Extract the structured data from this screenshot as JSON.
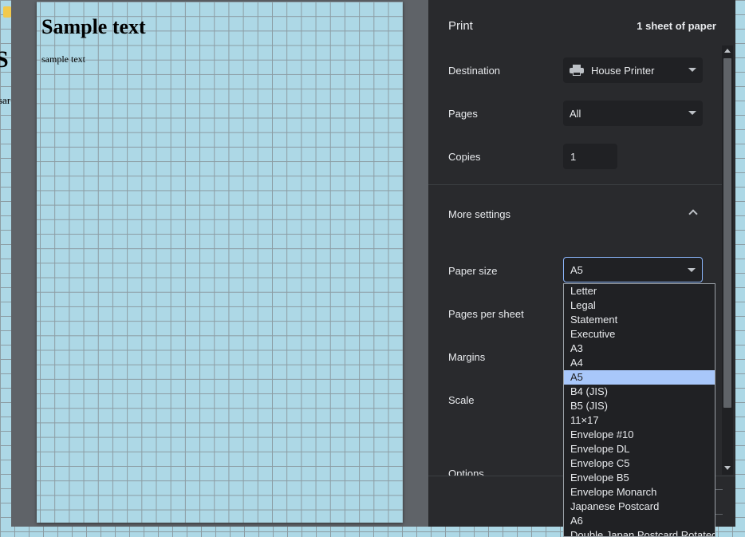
{
  "background_page": {
    "title": "S",
    "body": "sar"
  },
  "preview": {
    "title": "Sample text",
    "body": "sample text"
  },
  "print": {
    "title": "Print",
    "sheet_count": "1 sheet of paper",
    "destination": {
      "label": "Destination",
      "value": "House Printer",
      "icon": "printer-icon"
    },
    "pages": {
      "label": "Pages",
      "value": "All"
    },
    "copies": {
      "label": "Copies",
      "value": "1"
    },
    "more_settings": {
      "label": "More settings",
      "icon": "chevron-up-icon"
    },
    "paper_size": {
      "label": "Paper size",
      "value": "A5"
    },
    "pages_per_sheet": {
      "label": "Pages per sheet"
    },
    "margins": {
      "label": "Margins"
    },
    "scale": {
      "label": "Scale"
    },
    "options": {
      "label": "Options"
    }
  },
  "dropdown": {
    "selected": "A5",
    "options": [
      "Letter",
      "Legal",
      "Statement",
      "Executive",
      "A3",
      "A4",
      "A5",
      "B4 (JIS)",
      "B5 (JIS)",
      "11×17",
      "Envelope #10",
      "Envelope DL",
      "Envelope C5",
      "Envelope B5",
      "Envelope Monarch",
      "Japanese Postcard",
      "A6",
      "Double Japan Postcard Rotated"
    ]
  },
  "colors": {
    "sidebar_bg": "#292a2d",
    "field_bg": "#202124",
    "selected_option_bg": "#a8c7fa",
    "focus_border": "#8ab4f8",
    "paper_bg": "#add8e6"
  }
}
